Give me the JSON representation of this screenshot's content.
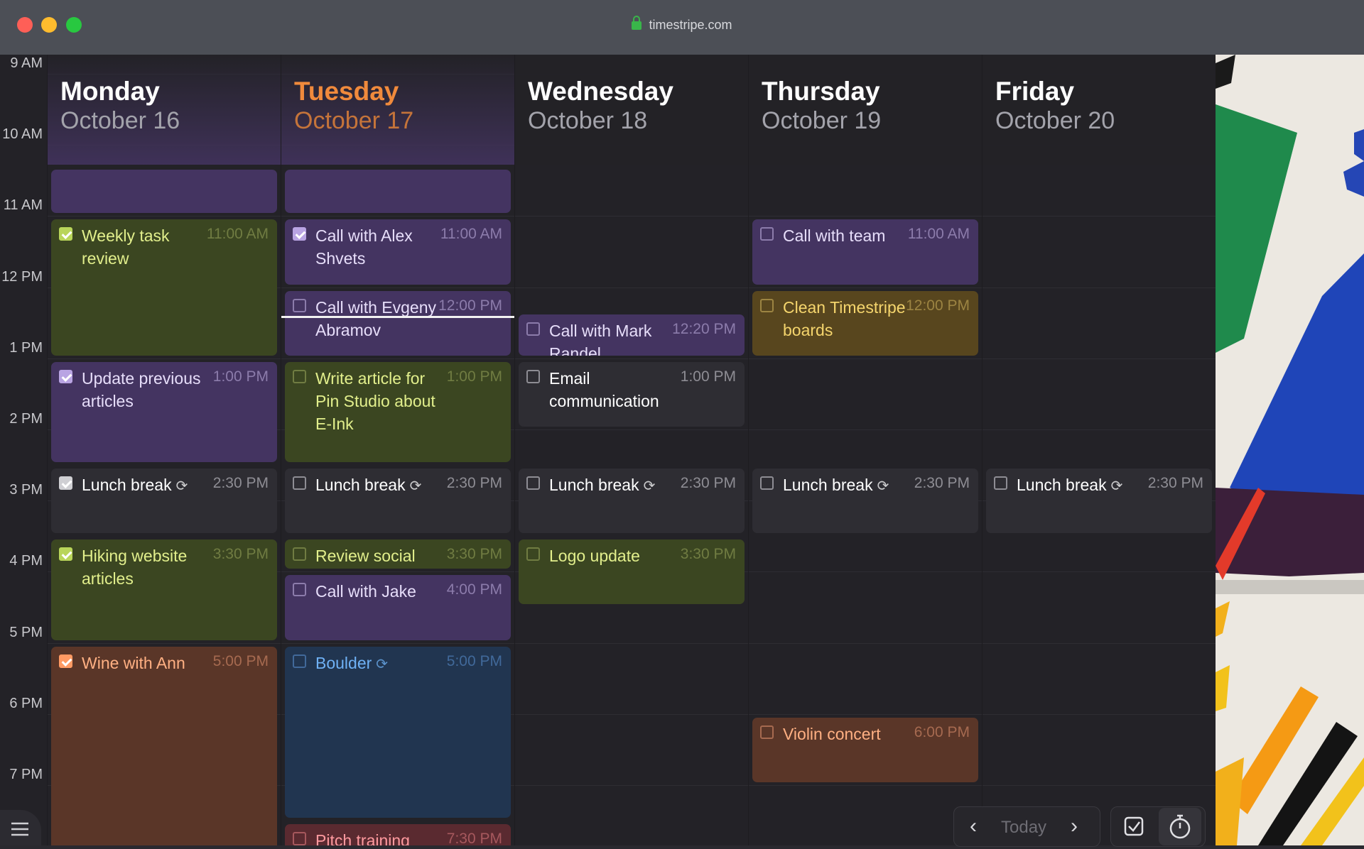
{
  "window": {
    "url": "timestripe.com"
  },
  "time_column": [
    "9 AM",
    "10 AM",
    "11 AM",
    "12 PM",
    "1 PM",
    "2 PM",
    "3 PM",
    "4 PM",
    "5 PM",
    "6 PM",
    "7 PM"
  ],
  "days": [
    {
      "name": "Monday",
      "date": "October 16",
      "today": false,
      "events": [
        {
          "title": "",
          "time": "",
          "start": 10.3,
          "end": 11.0,
          "color": "purple",
          "checkbox": false
        },
        {
          "title": "Weekly task review",
          "time": "11:00 AM",
          "start": 11.0,
          "end": 13.0,
          "color": "green",
          "checked": true
        },
        {
          "title": "Update previous articles",
          "time": "1:00 PM",
          "start": 13.0,
          "end": 14.5,
          "color": "purple",
          "checked": true
        },
        {
          "title": "Lunch break",
          "time": "2:30 PM",
          "start": 14.5,
          "end": 15.5,
          "color": "gray",
          "checked": true,
          "repeat": true
        },
        {
          "title": "Hiking website articles",
          "time": "3:30 PM",
          "start": 15.5,
          "end": 17.0,
          "color": "green",
          "checked": true
        },
        {
          "title": "Wine with Ann",
          "time": "5:00 PM",
          "start": 17.0,
          "end": 20.0,
          "color": "orange",
          "checked": true
        }
      ]
    },
    {
      "name": "Tuesday",
      "date": "October 17",
      "today": true,
      "events": [
        {
          "title": "",
          "time": "",
          "start": 10.3,
          "end": 11.0,
          "color": "purple",
          "checkbox": false
        },
        {
          "title": "Call with Alex Shvets",
          "time": "11:00 AM",
          "start": 11.0,
          "end": 12.0,
          "color": "purple",
          "checked": true
        },
        {
          "title": "Call with Evgeny Abramov",
          "time": "12:00 PM",
          "start": 12.0,
          "end": 13.0,
          "color": "purple",
          "checked": false
        },
        {
          "title": "Write article for Pin Studio about E-Ink",
          "time": "1:00 PM",
          "start": 13.0,
          "end": 14.5,
          "color": "green",
          "checked": false
        },
        {
          "title": "Lunch break",
          "time": "2:30 PM",
          "start": 14.5,
          "end": 15.5,
          "color": "gray",
          "checked": false,
          "repeat": true
        },
        {
          "title": "Review social",
          "time": "3:30 PM",
          "start": 15.5,
          "end": 16.0,
          "color": "green",
          "checked": false
        },
        {
          "title": "Call with Jake",
          "time": "4:00 PM",
          "start": 16.0,
          "end": 17.0,
          "color": "purple",
          "checked": false
        },
        {
          "title": "Boulder",
          "time": "5:00 PM",
          "start": 17.0,
          "end": 19.5,
          "color": "blue",
          "checked": false,
          "repeat": true
        },
        {
          "title": "Pitch training",
          "time": "7:30 PM",
          "start": 19.5,
          "end": 20.5,
          "color": "red",
          "checked": false
        }
      ]
    },
    {
      "name": "Wednesday",
      "date": "October 18",
      "today": false,
      "events": [
        {
          "title": "Call with Mark Randel",
          "time": "12:20 PM",
          "start": 12.333,
          "end": 13.0,
          "color": "purple",
          "checked": false
        },
        {
          "title": "Email communication",
          "time": "1:00 PM",
          "start": 13.0,
          "end": 14.0,
          "color": "gray",
          "checked": false
        },
        {
          "title": "Lunch break",
          "time": "2:30 PM",
          "start": 14.5,
          "end": 15.5,
          "color": "gray",
          "checked": false,
          "repeat": true
        },
        {
          "title": "Logo update",
          "time": "3:30 PM",
          "start": 15.5,
          "end": 16.5,
          "color": "green",
          "checked": false
        }
      ]
    },
    {
      "name": "Thursday",
      "date": "October 19",
      "today": false,
      "events": [
        {
          "title": "Call with team",
          "time": "11:00 AM",
          "start": 11.0,
          "end": 12.0,
          "color": "purple",
          "checked": false
        },
        {
          "title": "Clean Timestripe boards",
          "time": "12:00 PM",
          "start": 12.0,
          "end": 13.0,
          "color": "yellow",
          "checked": false
        },
        {
          "title": "Lunch break",
          "time": "2:30 PM",
          "start": 14.5,
          "end": 15.5,
          "color": "gray",
          "checked": false,
          "repeat": true
        },
        {
          "title": "Violin concert",
          "time": "6:00 PM",
          "start": 18.0,
          "end": 19.0,
          "color": "orange",
          "checked": false
        }
      ]
    },
    {
      "name": "Friday",
      "date": "October 20",
      "today": false,
      "events": [
        {
          "title": "Lunch break",
          "time": "2:30 PM",
          "start": 14.5,
          "end": 15.5,
          "color": "gray",
          "checked": false,
          "repeat": true
        }
      ]
    }
  ],
  "current_time": 12.4,
  "palette": {
    "purple": {
      "bg": "#443461",
      "title": "#e7defa",
      "time": "#8c7cab",
      "box": "#b9a4e3"
    },
    "green": {
      "bg": "#3b4621",
      "title": "#e2ef8c",
      "time": "#707c42",
      "box": "#b9d55a"
    },
    "orange": {
      "bg": "#5a3628",
      "title": "#ffb083",
      "time": "#a66a50",
      "box": "#ff9a63"
    },
    "gray": {
      "bg": "#2e2d33",
      "title": "#ffffff",
      "time": "#8e8d94",
      "box": "#cfcfd3"
    },
    "blue": {
      "bg": "#213550",
      "title": "#6fb1f5",
      "time": "#41699a",
      "box": "#5ea5ec"
    },
    "yellow": {
      "bg": "#58461e",
      "title": "#f5d56d",
      "time": "#9c8442",
      "box": "#e8c35a"
    },
    "red": {
      "bg": "#5a2a30",
      "title": "#ff9a9f",
      "time": "#a6585d",
      "box": "#ff8c93"
    }
  },
  "navigation": {
    "prev_icon": "chevron-left-icon",
    "today_label": "Today",
    "next_icon": "chevron-right-icon"
  },
  "tools": {
    "tasks_icon": "checkbox-icon",
    "timer_icon": "stopwatch-icon",
    "menu_icon": "hamburger-menu-icon"
  }
}
